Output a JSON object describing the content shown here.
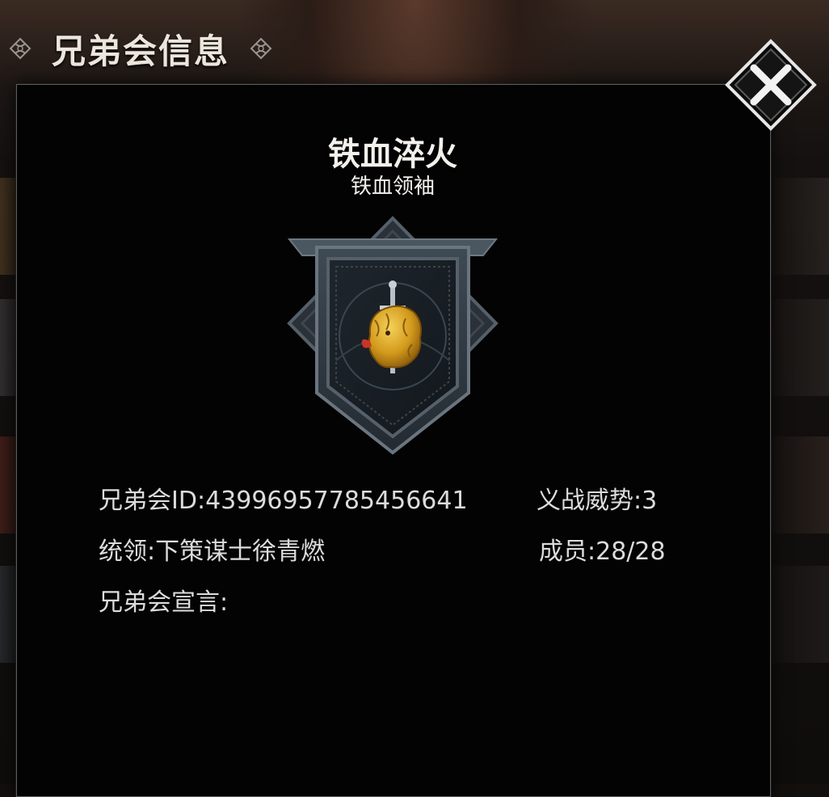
{
  "header": {
    "title": "兄弟会信息",
    "left_ornament_icon": "celtic-knot-icon",
    "right_ornament_icon": "celtic-knot-icon"
  },
  "close_button": {
    "icon": "close-x-icon"
  },
  "guild": {
    "name": "铁血淬火",
    "rank_title": "铁血领袖",
    "emblem_icon": "lion-sword-shield-emblem"
  },
  "info": {
    "guild_id_label": "兄弟会ID:",
    "guild_id_value": "43996957785456641",
    "prestige_label": "义战威势:",
    "prestige_value": "3",
    "leader_label": "统领:",
    "leader_value": "下策谋士徐青燃",
    "members_label": "成员:",
    "members_value": "28/28",
    "declaration_label": "兄弟会宣言:",
    "declaration_value": ""
  },
  "colors": {
    "panel_bg": "#030303",
    "text": "#dcdcdc",
    "title": "#ece6dc",
    "lion_gold": "#d8a21e"
  }
}
